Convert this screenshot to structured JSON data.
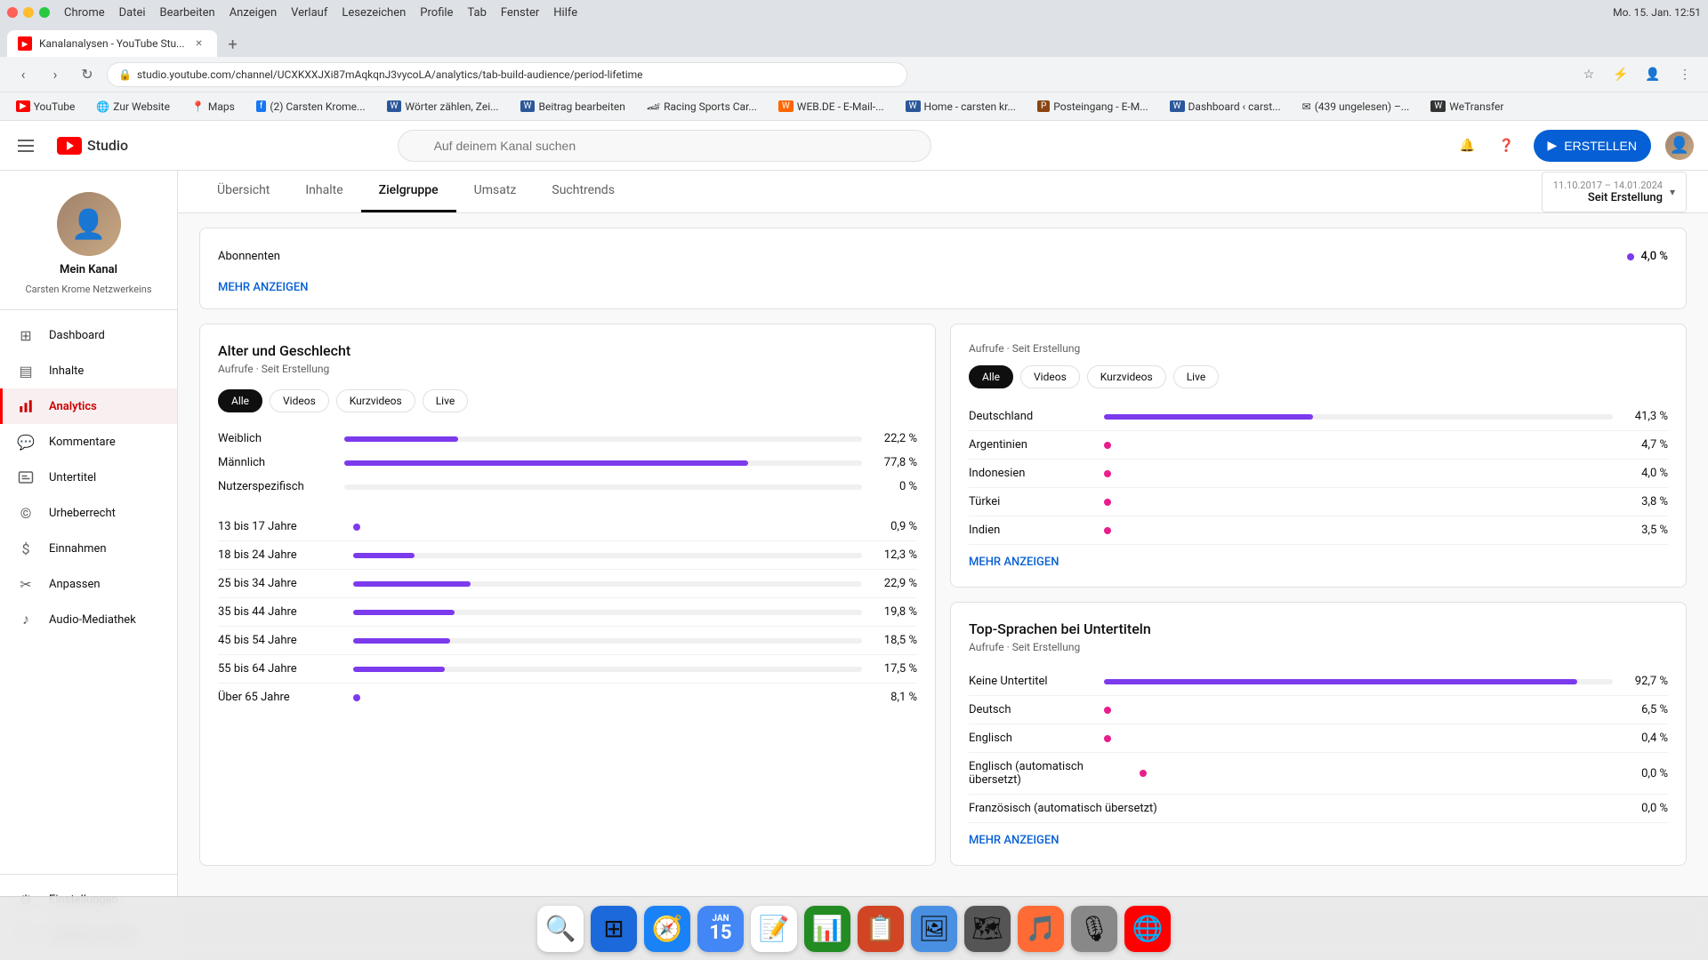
{
  "browser": {
    "menu_items": [
      "Chrome",
      "Datei",
      "Bearbeiten",
      "Anzeigen",
      "Verlauf",
      "Lesezeichen",
      "Profile",
      "Tab",
      "Fenster",
      "Hilfe"
    ],
    "tab_title": "Kanalanalysen - YouTube Stu...",
    "url": "studio.youtube.com/channel/UCXKXXJXi87mAqkqnJ3vycoLA/analytics/tab-build-audience/period-lifetime",
    "time": "Mo. 15. Jan. 12:51",
    "bookmarks": [
      {
        "label": "YouTube",
        "icon": "▶"
      },
      {
        "label": "Zur Website",
        "icon": "🌐"
      },
      {
        "label": "Maps",
        "icon": "📍"
      },
      {
        "label": "(2) Carsten Krome...",
        "icon": "f"
      },
      {
        "label": "Wörter zählen, Zei...",
        "icon": "W"
      },
      {
        "label": "Beitrag bearbeiten",
        "icon": "W"
      },
      {
        "label": "Racing Sports Car...",
        "icon": "🏎"
      },
      {
        "label": "WEB.DE - E-Mail-...",
        "icon": "W"
      },
      {
        "label": "Home - carsten kr...",
        "icon": "W"
      },
      {
        "label": "Posteingang - E-M...",
        "icon": "P"
      },
      {
        "label": "Dashboard ‹ carst...",
        "icon": "W"
      },
      {
        "label": "(439 ungelesen) –...",
        "icon": "✉"
      },
      {
        "label": "WeTransfer",
        "icon": "W"
      }
    ]
  },
  "app": {
    "logo_text": "Studio",
    "search_placeholder": "Auf deinem Kanal suchen",
    "create_label": "ERSTELLEN"
  },
  "channel": {
    "name": "Mein Kanal",
    "sub_name": "Carsten Krome Netzwerkeins"
  },
  "sidebar": {
    "items": [
      {
        "id": "dashboard",
        "label": "Dashboard",
        "icon": "⊞"
      },
      {
        "id": "inhalte",
        "label": "Inhalte",
        "icon": "▤"
      },
      {
        "id": "analytics",
        "label": "Analytics",
        "icon": "📊",
        "active": true
      },
      {
        "id": "kommentare",
        "label": "Kommentare",
        "icon": "💬"
      },
      {
        "id": "untertitel",
        "label": "Untertitel",
        "icon": "⬜"
      },
      {
        "id": "urheberrecht",
        "label": "Urheberrecht",
        "icon": "©"
      },
      {
        "id": "einnahmen",
        "label": "Einnahmen",
        "icon": "💰"
      },
      {
        "id": "anpassen",
        "label": "Anpassen",
        "icon": "✂"
      },
      {
        "id": "audio-mediathek",
        "label": "Audio-Mediathek",
        "icon": "♪"
      }
    ],
    "bottom_items": [
      {
        "id": "einstellungen",
        "label": "Einstellungen",
        "icon": "⚙"
      },
      {
        "id": "feedback",
        "label": "Feedback senden",
        "icon": "⚑"
      }
    ]
  },
  "analytics": {
    "tabs": [
      {
        "id": "uebersicht",
        "label": "Übersicht"
      },
      {
        "id": "inhalte",
        "label": "Inhalte"
      },
      {
        "id": "zielgruppe",
        "label": "Zielgruppe",
        "active": true
      },
      {
        "id": "umsatz",
        "label": "Umsatz"
      },
      {
        "id": "suchtrends",
        "label": "Suchtrends"
      }
    ],
    "date_range": {
      "small": "11.10.2017 – 14.01.2024",
      "main": "Seit Erstellung"
    }
  },
  "age_gender": {
    "title": "Alter und Geschlecht",
    "subtitle": "Aufrufe · Seit Erstellung",
    "filter_pills": [
      "Alle",
      "Videos",
      "Kurzvideos",
      "Live"
    ],
    "active_pill": "Alle",
    "gender_rows": [
      {
        "label": "Weiblich",
        "value": "22,2 %",
        "bar_pct": 22,
        "bar_class": "bar-purple"
      },
      {
        "label": "Männlich",
        "value": "77,8 %",
        "bar_pct": 78,
        "bar_class": "bar-purple"
      },
      {
        "label": "Nutzerspezifisch",
        "value": "0 %",
        "bar_pct": 0,
        "bar_class": "bar-purple"
      }
    ],
    "age_rows": [
      {
        "label": "13 bis 17 Jahre",
        "value": "0,9 %",
        "bar_pct": 1,
        "dot": true
      },
      {
        "label": "18 bis 24 Jahre",
        "value": "12,3 %",
        "bar_pct": 12
      },
      {
        "label": "25 bis 34 Jahre",
        "value": "22,9 %",
        "bar_pct": 23
      },
      {
        "label": "35 bis 44 Jahre",
        "value": "19,8 %",
        "bar_pct": 20
      },
      {
        "label": "45 bis 54 Jahre",
        "value": "18,5 %",
        "bar_pct": 19
      },
      {
        "label": "55 bis 64 Jahre",
        "value": "17,5 %",
        "bar_pct": 18
      },
      {
        "label": "Über 65 Jahre",
        "value": "8,1 %",
        "bar_pct": 8
      }
    ]
  },
  "subscribers": {
    "label": "Abonnenten",
    "value": "4,0 %",
    "more_label": "MEHR ANZEIGEN"
  },
  "top_countries": {
    "title_prefix": "Aufrufe",
    "title_suffix": "Seit Erstellung",
    "filter_pills": [
      "Alle",
      "Videos",
      "Kurzvideos",
      "Live"
    ],
    "active_pill": "Alle",
    "rows": [
      {
        "label": "Deutschland",
        "value": "41,3 %",
        "bar_pct": 41,
        "bar_class": "bar-purple"
      },
      {
        "label": "Argentinien",
        "value": "4,7 %",
        "bar_pct": 5,
        "bar_class": "bar-pink"
      },
      {
        "label": "Indonesien",
        "value": "4,0 %",
        "bar_pct": 4,
        "bar_class": "bar-pink"
      },
      {
        "label": "Türkei",
        "value": "3,8 %",
        "bar_pct": 4,
        "bar_class": "bar-pink"
      },
      {
        "label": "Indien",
        "value": "3,5 %",
        "bar_pct": 4,
        "bar_class": "bar-pink"
      }
    ],
    "more_label": "MEHR ANZEIGEN"
  },
  "top_languages": {
    "title": "Top-Sprachen bei Untertiteln",
    "subtitle": "Aufrufe · Seit Erstellung",
    "rows": [
      {
        "label": "Keine Untertitel",
        "value": "92,7 %",
        "bar_pct": 93,
        "has_bar": true
      },
      {
        "label": "Deutsch",
        "value": "6,5 %",
        "bar_pct": 7,
        "has_dot": true
      },
      {
        "label": "Englisch",
        "value": "0,4 %",
        "bar_pct": 1,
        "has_dot": true
      },
      {
        "label": "Englisch (automatisch übersetzt)",
        "value": "0,0 %",
        "bar_pct": 0,
        "has_dot": true
      },
      {
        "label": "Französisch (automatisch übersetzt)",
        "value": "0,0 %",
        "bar_pct": 0
      }
    ],
    "more_label": "MEHR ANZEIGEN"
  }
}
